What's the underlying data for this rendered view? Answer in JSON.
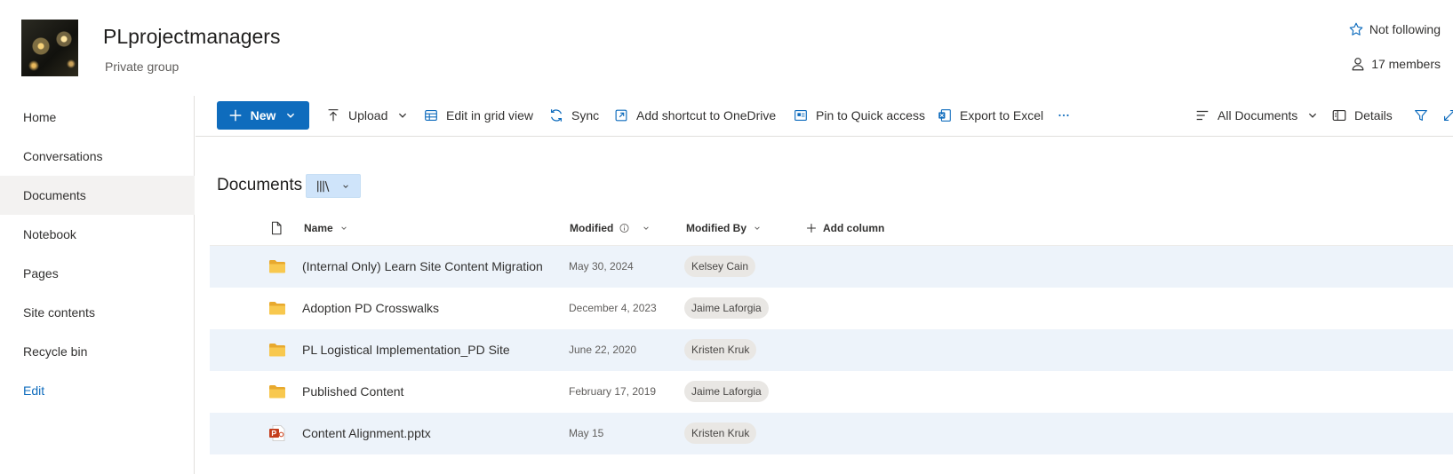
{
  "site": {
    "title": "PLprojectmanagers",
    "subtitle": "Private group",
    "follow_label": "Not following",
    "members_label": "17 members"
  },
  "sidebar": {
    "items": [
      {
        "label": "Home"
      },
      {
        "label": "Conversations"
      },
      {
        "label": "Documents",
        "active": true
      },
      {
        "label": "Notebook"
      },
      {
        "label": "Pages"
      },
      {
        "label": "Site contents"
      },
      {
        "label": "Recycle bin"
      }
    ],
    "edit_label": "Edit"
  },
  "toolbar": {
    "new_label": "New",
    "upload_label": "Upload",
    "grid_label": "Edit in grid view",
    "sync_label": "Sync",
    "shortcut_label": "Add shortcut to OneDrive",
    "pin_label": "Pin to Quick access",
    "export_label": "Export to Excel",
    "view_label": "All Documents",
    "details_label": "Details"
  },
  "library": {
    "title": "Documents",
    "columns": {
      "name": "Name",
      "modified": "Modified",
      "modified_by": "Modified By",
      "add_column": "Add column"
    },
    "rows": [
      {
        "type": "folder",
        "name": "(Internal Only) Learn Site Content Migration",
        "modified": "May 30, 2024",
        "modified_by": "Kelsey Cain"
      },
      {
        "type": "folder",
        "name": "Adoption PD Crosswalks",
        "modified": "December 4, 2023",
        "modified_by": "Jaime Laforgia"
      },
      {
        "type": "folder",
        "name": "PL Logistical Implementation_PD Site",
        "modified": "June 22, 2020",
        "modified_by": "Kristen Kruk"
      },
      {
        "type": "folder",
        "name": "Published Content",
        "modified": "February 17, 2019",
        "modified_by": "Jaime Laforgia"
      },
      {
        "type": "pptx",
        "name": "Content Alignment.pptx",
        "modified": "May 15",
        "modified_by": "Kristen Kruk"
      }
    ]
  },
  "colors": {
    "accent": "#0f6cbd",
    "row_shade": "#edf3fa",
    "folder": "#f4c14c",
    "pptx": "#c43e1c"
  }
}
